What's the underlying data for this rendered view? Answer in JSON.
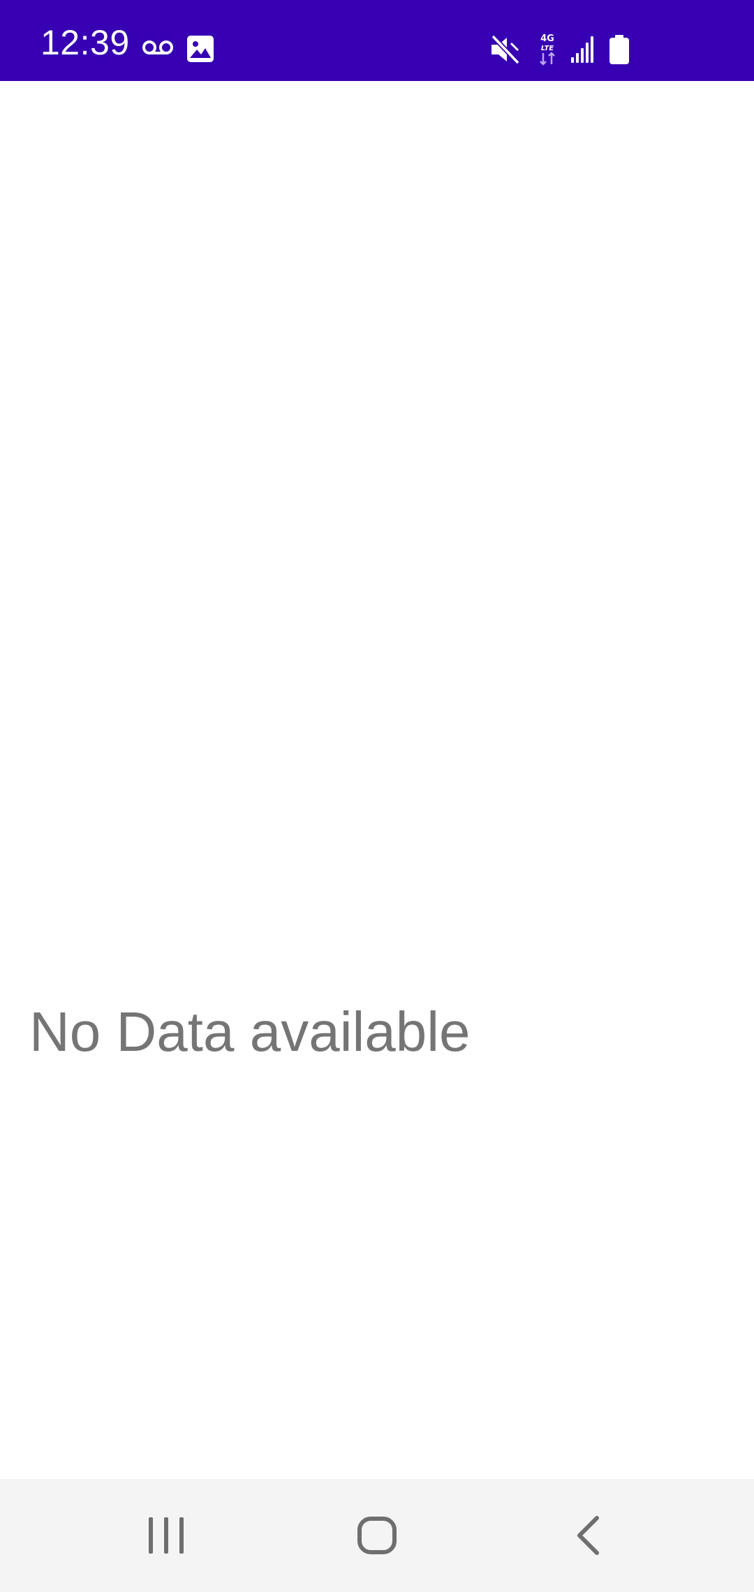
{
  "status_bar": {
    "time": "12:39",
    "background_color": "#3700b3",
    "left_icons": [
      "voicemail-icon",
      "image-icon"
    ],
    "right_icons": [
      "mute-icon",
      "4g-lte-icon",
      "signal-icon",
      "battery-icon"
    ],
    "network_label_top": "4G",
    "network_label_bottom": "LTE"
  },
  "main": {
    "empty_message": "No Data available",
    "text_color": "#757575"
  },
  "nav_bar": {
    "buttons": [
      "recent-apps",
      "home",
      "back"
    ],
    "background_color": "#f4f4f4"
  }
}
